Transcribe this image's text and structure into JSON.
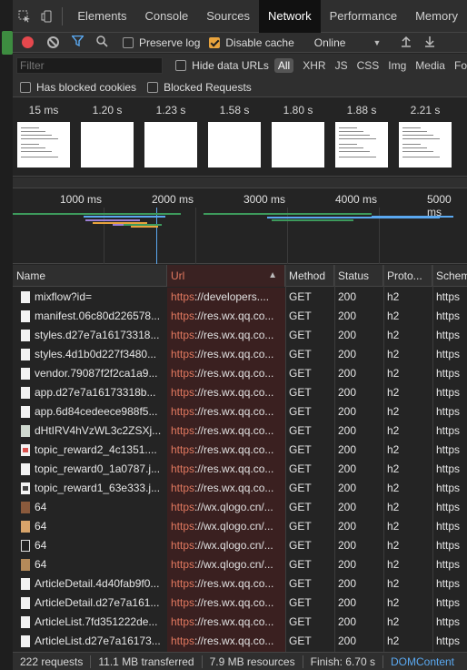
{
  "tabs": [
    {
      "label": "Elements"
    },
    {
      "label": "Console"
    },
    {
      "label": "Sources"
    },
    {
      "label": "Network"
    },
    {
      "label": "Performance"
    },
    {
      "label": "Memory"
    }
  ],
  "active_tab": "Network",
  "toolbar": {
    "preserve_log": "Preserve log",
    "preserve_log_checked": false,
    "disable_cache": "Disable cache",
    "disable_cache_checked": true,
    "throttle": "Online"
  },
  "filter": {
    "placeholder": "Filter",
    "hide_data_urls": "Hide data URLs",
    "types": [
      "All",
      "XHR",
      "JS",
      "CSS",
      "Img",
      "Media",
      "Fo"
    ]
  },
  "blocked": {
    "has_blocked_cookies": "Has blocked cookies",
    "blocked_requests": "Blocked Requests"
  },
  "screenshots": [
    {
      "time": "15 ms",
      "content": "page"
    },
    {
      "time": "1.20 s",
      "content": "blank"
    },
    {
      "time": "1.23 s",
      "content": "blank"
    },
    {
      "time": "1.58 s",
      "content": "blank"
    },
    {
      "time": "1.80 s",
      "content": "blank"
    },
    {
      "time": "1.88 s",
      "content": "page"
    },
    {
      "time": "2.21 s",
      "content": "page"
    }
  ],
  "overview_ticks": [
    "1000 ms",
    "2000 ms",
    "3000 ms",
    "4000 ms",
    "5000 ms"
  ],
  "columns": {
    "name": "Name",
    "url": "Url",
    "method": "Method",
    "status": "Status",
    "protocol": "Proto...",
    "scheme": "Schem"
  },
  "rows": [
    {
      "name": "mixflow?id=",
      "proto": "https",
      "rest": "://developers....",
      "method": "GET",
      "status": "200",
      "protocol": "h2",
      "scheme": "https",
      "icon": "doc"
    },
    {
      "name": "manifest.06c80d226578...",
      "proto": "https",
      "rest": "://res.wx.qq.co...",
      "method": "GET",
      "status": "200",
      "protocol": "h2",
      "scheme": "https",
      "icon": "doc"
    },
    {
      "name": "styles.d27e7a16173318...",
      "proto": "https",
      "rest": "://res.wx.qq.co...",
      "method": "GET",
      "status": "200",
      "protocol": "h2",
      "scheme": "https",
      "icon": "doc"
    },
    {
      "name": "styles.4d1b0d227f3480...",
      "proto": "https",
      "rest": "://res.wx.qq.co...",
      "method": "GET",
      "status": "200",
      "protocol": "h2",
      "scheme": "https",
      "icon": "doc"
    },
    {
      "name": "vendor.79087f2f2ca1a9...",
      "proto": "https",
      "rest": "://res.wx.qq.co...",
      "method": "GET",
      "status": "200",
      "protocol": "h2",
      "scheme": "https",
      "icon": "doc"
    },
    {
      "name": "app.d27e7a16173318b...",
      "proto": "https",
      "rest": "://res.wx.qq.co...",
      "method": "GET",
      "status": "200",
      "protocol": "h2",
      "scheme": "https",
      "icon": "doc"
    },
    {
      "name": "app.6d84cedeece988f5...",
      "proto": "https",
      "rest": "://res.wx.qq.co...",
      "method": "GET",
      "status": "200",
      "protocol": "h2",
      "scheme": "https",
      "icon": "doc"
    },
    {
      "name": "dHtIRV4hVzWL3c2ZSXj...",
      "proto": "https",
      "rest": "://res.wx.qq.co...",
      "method": "GET",
      "status": "200",
      "protocol": "h2",
      "scheme": "https",
      "icon": "grid"
    },
    {
      "name": "topic_reward2_4c1351....",
      "proto": "https",
      "rest": "://res.wx.qq.co...",
      "method": "GET",
      "status": "200",
      "protocol": "h2",
      "scheme": "https",
      "icon": "img-red"
    },
    {
      "name": "topic_reward0_1a0787.j...",
      "proto": "https",
      "rest": "://res.wx.qq.co...",
      "method": "GET",
      "status": "200",
      "protocol": "h2",
      "scheme": "https",
      "icon": "doc"
    },
    {
      "name": "topic_reward1_63e333.j...",
      "proto": "https",
      "rest": "://res.wx.qq.co...",
      "method": "GET",
      "status": "200",
      "protocol": "h2",
      "scheme": "https",
      "icon": "img-dark"
    },
    {
      "name": "64",
      "proto": "https",
      "rest": "://wx.qlogo.cn/...",
      "method": "GET",
      "status": "200",
      "protocol": "h2",
      "scheme": "https",
      "icon": "avatar"
    },
    {
      "name": "64",
      "proto": "https",
      "rest": "://wx.qlogo.cn/...",
      "method": "GET",
      "status": "200",
      "protocol": "h2",
      "scheme": "https",
      "icon": "avatar2"
    },
    {
      "name": "64",
      "proto": "https",
      "rest": "://wx.qlogo.cn/...",
      "method": "GET",
      "status": "200",
      "protocol": "h2",
      "scheme": "https",
      "icon": "avatar3"
    },
    {
      "name": "64",
      "proto": "https",
      "rest": "://wx.qlogo.cn/...",
      "method": "GET",
      "status": "200",
      "protocol": "h2",
      "scheme": "https",
      "icon": "avatar4"
    },
    {
      "name": "ArticleDetail.4d40fab9f0...",
      "proto": "https",
      "rest": "://res.wx.qq.co...",
      "method": "GET",
      "status": "200",
      "protocol": "h2",
      "scheme": "https",
      "icon": "doc"
    },
    {
      "name": "ArticleDetail.d27e7a161...",
      "proto": "https",
      "rest": "://res.wx.qq.co...",
      "method": "GET",
      "status": "200",
      "protocol": "h2",
      "scheme": "https",
      "icon": "doc"
    },
    {
      "name": "ArticleList.7fd351222de...",
      "proto": "https",
      "rest": "://res.wx.qq.co...",
      "method": "GET",
      "status": "200",
      "protocol": "h2",
      "scheme": "https",
      "icon": "doc"
    },
    {
      "name": "ArticleList.d27e7a16173...",
      "proto": "https",
      "rest": "://res.wx.qq.co...",
      "method": "GET",
      "status": "200",
      "protocol": "h2",
      "scheme": "https",
      "icon": "doc"
    }
  ],
  "status": {
    "requests": "222 requests",
    "transferred": "11.1 MB transferred",
    "resources": "7.9 MB resources",
    "finish": "Finish: 6.70 s",
    "dom": "DOMContent"
  },
  "colors": {
    "record": "#e5484d",
    "accent": "#5aa8f0",
    "url_header": "#e0785f",
    "checkbox_on": "#e8a33d"
  }
}
